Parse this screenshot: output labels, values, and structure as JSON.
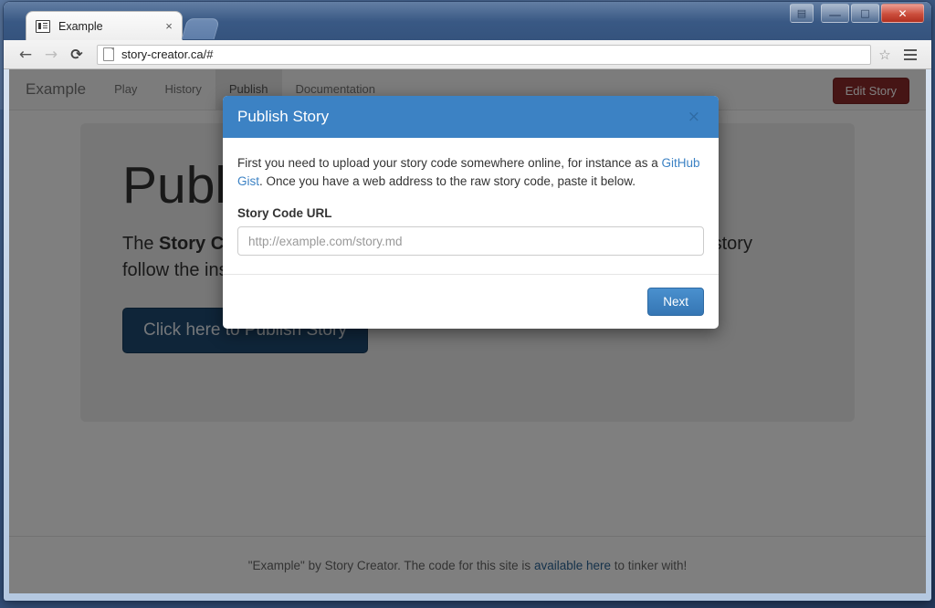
{
  "browser": {
    "tab": {
      "title": "Example",
      "close_label": "×"
    },
    "new_tab_name": "new-tab-button",
    "nav": {
      "back": "←",
      "forward": "→",
      "reload": "⟳"
    },
    "url": "story-creator.ca/#",
    "star": "☆",
    "window_controls": {
      "user": "▤",
      "minimize": "—",
      "maximize": "□",
      "close": "✕"
    }
  },
  "navbar": {
    "brand": "Example",
    "links": [
      {
        "label": "Play",
        "active": false
      },
      {
        "label": "History",
        "active": false
      },
      {
        "label": "Publish",
        "active": true
      },
      {
        "label": "Documentation",
        "active": false
      }
    ],
    "edit_story_label": "Edit Story",
    "edit_story_color": "#8d2a2a"
  },
  "jumbotron": {
    "title": "Publish",
    "body_part1": "The ",
    "body_bold": "Story Creator",
    "body_part2": " is free to use and so does your story! To publish your story follow the instructions provided. Cheers!",
    "publish_button_label": "Click here to Publish Story",
    "publish_button_color": "#1e4a72"
  },
  "footer": {
    "text_before": "\"Example\" by Story Creator. The code for this site is ",
    "link": "available here",
    "text_after": " to tinker with!"
  },
  "modal": {
    "title": "Publish Story",
    "close_label": "×",
    "header_color": "#3c82c4",
    "desc_part1": "First you need to upload your story code somewhere online, for instance as a ",
    "desc_link": "GitHub Gist",
    "desc_part2": ". Once you have a web address to the raw story code, paste it below.",
    "url_label": "Story Code URL",
    "url_value": "",
    "url_placeholder": "http://example.com/story.md",
    "next_label": "Next"
  }
}
